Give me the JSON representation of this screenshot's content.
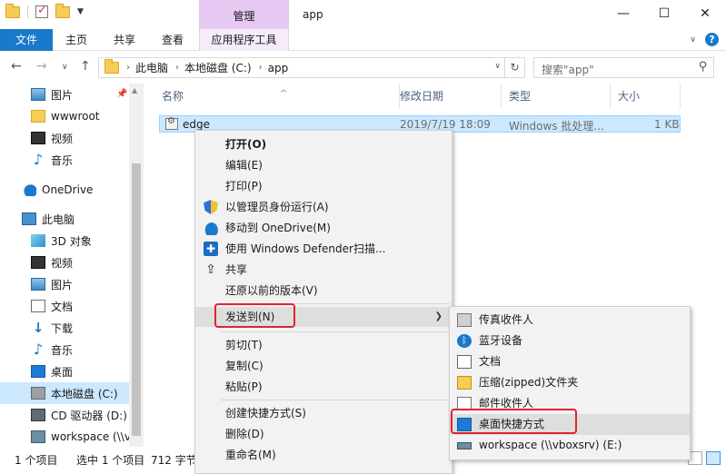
{
  "window": {
    "title": "app",
    "context_tab_header": "管理",
    "minimize": "—",
    "maximize": "☐",
    "close": "✕"
  },
  "ribbon": {
    "file": "文件",
    "home": "主页",
    "share": "共享",
    "view": "查看",
    "app_tools": "应用程序工具"
  },
  "address": {
    "crumbs": [
      "此电脑",
      "本地磁盘 (C:)",
      "app"
    ],
    "search_placeholder": "搜索\"app\""
  },
  "nav": {
    "items": [
      {
        "label": "图片",
        "icon": "pictures-icon"
      },
      {
        "label": "wwwroot",
        "icon": "folder-icon"
      },
      {
        "label": "视频",
        "icon": "video-icon"
      },
      {
        "label": "音乐",
        "icon": "music-icon"
      },
      {
        "label": "OneDrive",
        "icon": "onedrive-icon"
      },
      {
        "label": "此电脑",
        "icon": "this-pc-icon"
      },
      {
        "label": "3D 对象",
        "icon": "3d-objects-icon"
      },
      {
        "label": "视频",
        "icon": "video-icon"
      },
      {
        "label": "图片",
        "icon": "pictures-icon"
      },
      {
        "label": "文档",
        "icon": "documents-icon"
      },
      {
        "label": "下载",
        "icon": "downloads-icon"
      },
      {
        "label": "音乐",
        "icon": "music-icon"
      },
      {
        "label": "桌面",
        "icon": "desktop-icon"
      },
      {
        "label": "本地磁盘 (C:)",
        "icon": "drive-icon"
      },
      {
        "label": "CD 驱动器 (D:) V",
        "icon": "cd-drive-icon"
      },
      {
        "label": "workspace (\\\\v",
        "icon": "network-drive-icon"
      }
    ]
  },
  "list": {
    "columns": [
      "名称",
      "修改日期",
      "类型",
      "大小"
    ],
    "rows": [
      {
        "name": "edge",
        "date": "2019/7/19 18:09",
        "type": "Windows 批处理...",
        "size": "1 KB"
      }
    ]
  },
  "status": {
    "count": "1 个项目",
    "selected": "选中 1 个项目",
    "size": "712 字节"
  },
  "context_menu": {
    "items": [
      "打开(O)",
      "编辑(E)",
      "打印(P)",
      "以管理员身份运行(A)",
      "移动到 OneDrive(M)",
      "使用 Windows Defender扫描...",
      "共享",
      "还原以前的版本(V)",
      "发送到(N)",
      "剪切(T)",
      "复制(C)",
      "粘贴(P)",
      "创建快捷方式(S)",
      "删除(D)",
      "重命名(M)"
    ]
  },
  "send_to_menu": {
    "items": [
      "传真收件人",
      "蓝牙设备",
      "文档",
      "压缩(zipped)文件夹",
      "邮件收件人",
      "桌面快捷方式",
      "workspace (\\\\vboxsrv) (E:)"
    ]
  },
  "colors": {
    "accent": "#1979ca",
    "context_tab": "#e6c8f2",
    "selection": "#cce8ff",
    "highlight_box": "#e0242c"
  }
}
